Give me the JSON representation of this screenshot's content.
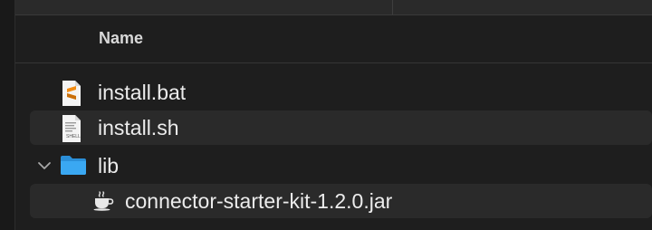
{
  "header": {
    "name_column": "Name"
  },
  "files": [
    {
      "label": "install.bat",
      "icon": "sublime-file-icon"
    },
    {
      "label": "install.sh",
      "icon": "shell-script-icon",
      "icon_caption": "SHELL"
    },
    {
      "label": "lib",
      "icon": "folder-icon",
      "expanded": true
    },
    {
      "label": "connector-starter-kit-1.2.0.jar",
      "icon": "java-coffee-icon"
    }
  ],
  "colors": {
    "background": "#1e1e1e",
    "row_highlight": "#2a2a2a",
    "folder": "#3aa8f2",
    "sublime_orange": "#f28c13"
  }
}
